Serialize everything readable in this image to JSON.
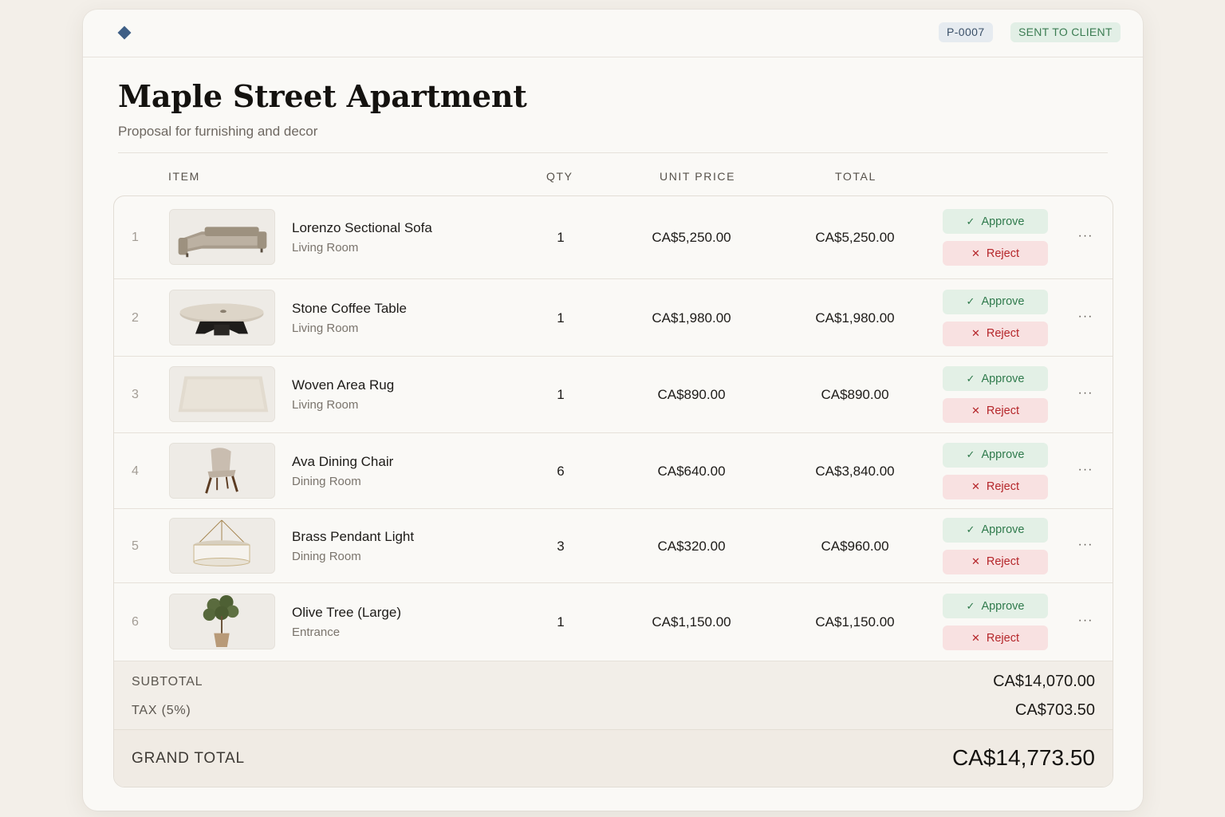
{
  "header": {
    "proposal_id": "P-0007",
    "status": "SENT TO CLIENT"
  },
  "proposal": {
    "title": "Maple Street Apartment",
    "subtitle": "Proposal for furnishing and decor"
  },
  "columns": {
    "item": "ITEM",
    "qty": "QTY",
    "unit_price": "UNIT PRICE",
    "total": "TOTAL"
  },
  "actions": {
    "approve_label": "Approve",
    "reject_label": "Reject",
    "more_label": "···"
  },
  "items": [
    {
      "num": "1",
      "name": "Lorenzo Sectional Sofa",
      "room": "Living Room",
      "qty": "1",
      "unit": "CA$5,250.00",
      "total": "CA$5,250.00",
      "icon": "sofa-image"
    },
    {
      "num": "2",
      "name": "Stone Coffee Table",
      "room": "Living Room",
      "qty": "1",
      "unit": "CA$1,980.00",
      "total": "CA$1,980.00",
      "icon": "coffee-table-image"
    },
    {
      "num": "3",
      "name": "Woven Area Rug",
      "room": "Living Room",
      "qty": "1",
      "unit": "CA$890.00",
      "total": "CA$890.00",
      "icon": "rug-image"
    },
    {
      "num": "4",
      "name": "Ava Dining Chair",
      "room": "Dining Room",
      "qty": "6",
      "unit": "CA$640.00",
      "total": "CA$3,840.00",
      "icon": "chair-image"
    },
    {
      "num": "5",
      "name": "Brass Pendant Light",
      "room": "Dining Room",
      "qty": "3",
      "unit": "CA$320.00",
      "total": "CA$960.00",
      "icon": "pendant-light-image"
    },
    {
      "num": "6",
      "name": "Olive Tree (Large)",
      "room": "Entrance",
      "qty": "1",
      "unit": "CA$1,150.00",
      "total": "CA$1,150.00",
      "icon": "olive-tree-image"
    }
  ],
  "summary": {
    "subtotal_label": "SUBTOTAL",
    "subtotal": "CA$14,070.00",
    "tax_label": "TAX (5%)",
    "tax": "CA$703.50",
    "grand_label": "GRAND TOTAL",
    "grand_total": "CA$14,773.50"
  },
  "colors": {
    "accent": "#3f5f86",
    "approve": "#2f7a4c",
    "reject": "#b5262a",
    "status": "#3b7c52"
  }
}
